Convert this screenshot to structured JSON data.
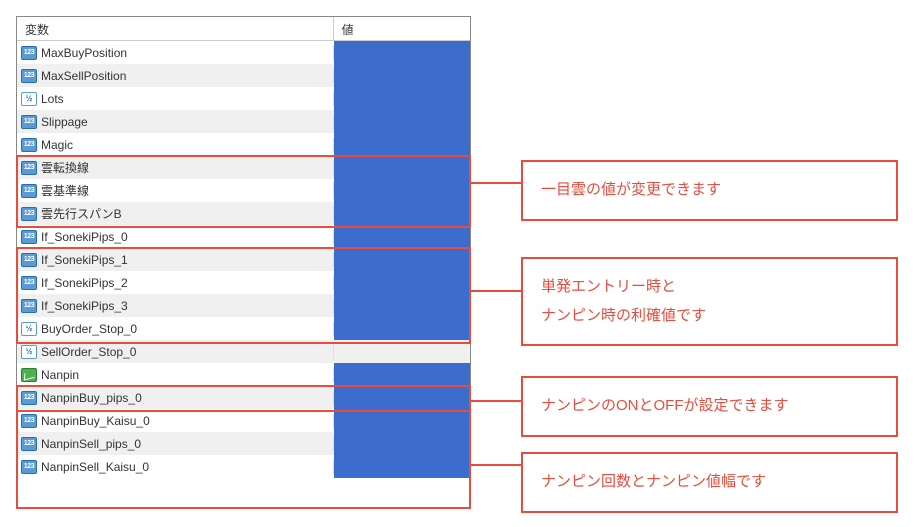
{
  "header": {
    "var_col": "変数",
    "val_col": "値"
  },
  "rows": [
    {
      "icon": "123",
      "name": "MaxBuyPosition",
      "selected": true
    },
    {
      "icon": "123",
      "name": "MaxSellPosition",
      "selected": true
    },
    {
      "icon": "12",
      "name": "Lots",
      "selected": true
    },
    {
      "icon": "123",
      "name": "Slippage",
      "selected": true
    },
    {
      "icon": "123",
      "name": "Magic",
      "selected": true
    },
    {
      "icon": "123",
      "name": "雲転換線",
      "selected": true
    },
    {
      "icon": "123",
      "name": "雲基準線",
      "selected": true
    },
    {
      "icon": "123",
      "name": "雲先行スパンB",
      "selected": true
    },
    {
      "icon": "123",
      "name": "If_SonekiPips_0",
      "selected": true
    },
    {
      "icon": "123",
      "name": "If_SonekiPips_1",
      "selected": true
    },
    {
      "icon": "123",
      "name": "If_SonekiPips_2",
      "selected": true
    },
    {
      "icon": "123",
      "name": "If_SonekiPips_3",
      "selected": true
    },
    {
      "icon": "12",
      "name": "BuyOrder_Stop_0",
      "selected": true
    },
    {
      "icon": "12",
      "name": "SellOrder_Stop_0",
      "selected": false
    },
    {
      "icon": "chart",
      "name": "Nanpin",
      "selected": true
    },
    {
      "icon": "123",
      "name": "NanpinBuy_pips_0",
      "selected": true
    },
    {
      "icon": "123",
      "name": "NanpinBuy_Kaisu_0",
      "selected": true
    },
    {
      "icon": "123",
      "name": "NanpinSell_pips_0",
      "selected": true
    },
    {
      "icon": "123",
      "name": "NanpinSell_Kaisu_0",
      "selected": true
    }
  ],
  "annotations": {
    "a1": "一目雲の値が変更できます",
    "a2": "単発エントリー時と\nナンピン時の利確値です",
    "a3": "ナンピンのONとOFFが設定できます",
    "a4": "ナンピン回数とナンピン値幅です"
  },
  "icon_text": {
    "123": "123",
    "12": "½"
  }
}
